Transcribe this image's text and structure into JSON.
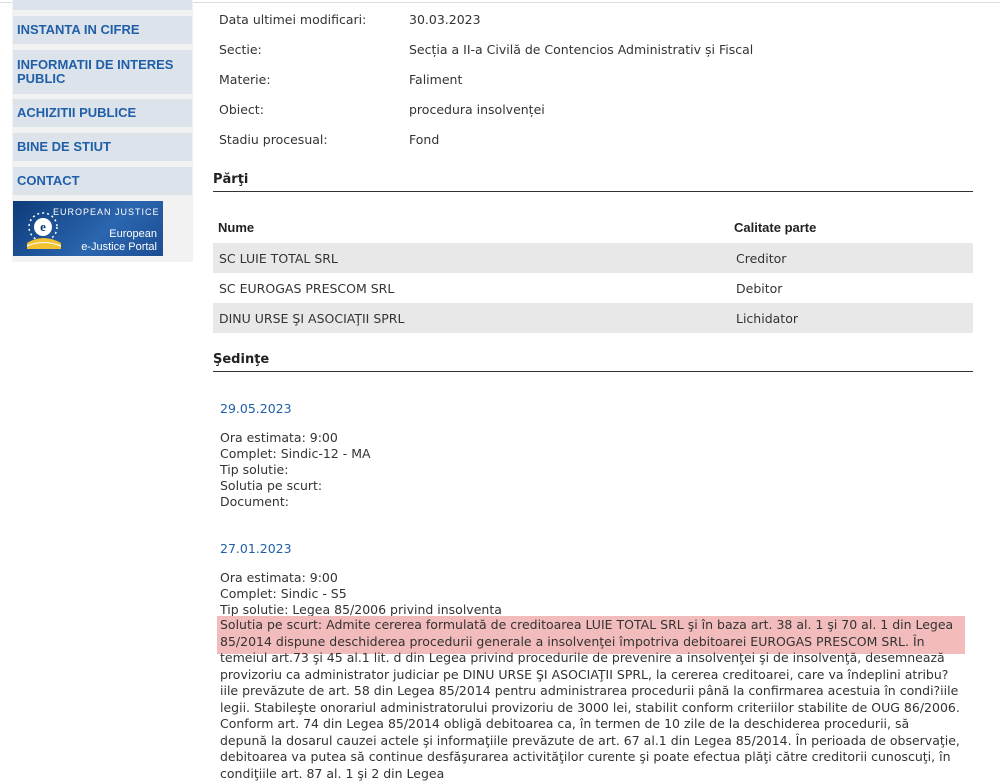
{
  "sidebar": {
    "items": [
      {
        "label": "INSTANTA IN CIFRE"
      },
      {
        "label": "INFORMATII DE INTERES PUBLIC"
      },
      {
        "label": "ACHIZITII PUBLICE"
      },
      {
        "label": "BINE DE STIUT"
      },
      {
        "label": "CONTACT"
      }
    ],
    "banner": {
      "small_text": "EUROPEAN JUSTICE",
      "title_line1": "European",
      "title_line2": "e-Justice Portal"
    }
  },
  "details": [
    {
      "label": "Data ultimei modificari:",
      "value": "30.03.2023"
    },
    {
      "label": "Sectie:",
      "value": "Secția a II-a Civilă de Contencios Administrativ și Fiscal"
    },
    {
      "label": "Materie:",
      "value": "Faliment"
    },
    {
      "label": "Obiect:",
      "value": "procedura insolvenței"
    },
    {
      "label": "Stadiu procesual:",
      "value": "Fond"
    }
  ],
  "parti": {
    "title": "Părţi",
    "columns": [
      "Nume",
      "Calitate parte"
    ],
    "rows": [
      {
        "nume": "SC LUIE TOTAL SRL",
        "calitate": "Creditor"
      },
      {
        "nume": "SC EUROGAS PRESCOM SRL",
        "calitate": "Debitor"
      },
      {
        "nume": "DINU URSE ŞI ASOCIAŢII SPRL",
        "calitate": "Lichidator"
      }
    ]
  },
  "sedinte": {
    "title": "Şedinţe",
    "items": [
      {
        "date": "29.05.2023",
        "ora": "Ora estimata: 9:00",
        "complet": "Complet: Sindic-12 - MA",
        "tip": "Tip solutie:",
        "solutie": "Solutia pe scurt:",
        "document": "Document:"
      },
      {
        "date": "27.01.2023",
        "ora": "Ora estimata: 9:00",
        "complet": "Complet: Sindic - S5",
        "tip": "Tip solutie: Legea 85/2006 privind insolventa",
        "solutie": "Solutia pe scurt: Admite cererea formulată de creditoarea LUIE TOTAL SRL şi în baza art. 38 al. 1 şi 70 al. 1 din Legea 85/2014 dispune deschiderea procedurii generale a insolvenţei împotriva debitoarei EUROGAS PRESCOM SRL. În temeiul art.73 şi 45 al.1 lit. d din Legea privind procedurile de prevenire a insolvenţei şi de insolvenţă, desemnează provizoriu ca administrator judiciar pe DINU URSE ŞI ASOCIAŢII SPRL, la cererea creditoarei, care va îndeplini atribu?iile prevăzute de art. 58 din Legea 85/2014 pentru administrarea procedurii până la confirmarea acestuia în condi?iile legii. Stabileşte onorariul administratorului provizoriu de 3000 lei, stabilit conform criteriilor stabilite de OUG 86/2006. Conform art. 74 din Legea 85/2014 obligă debitoarea ca, în termen de 10 zile de la deschiderea procedurii, să depună la dosarul cauzei actele şi informaţiile prevăzute de art. 67 al.1 din Legea 85/2014. În perioada de observaţie, debitoarea va putea să continue desfăşurarea activităţilor curente şi poate efectua plăţi către creditorii cunoscuţi, în condiţiile art. 87 al. 1 şi 2 din Legea"
      }
    ]
  }
}
